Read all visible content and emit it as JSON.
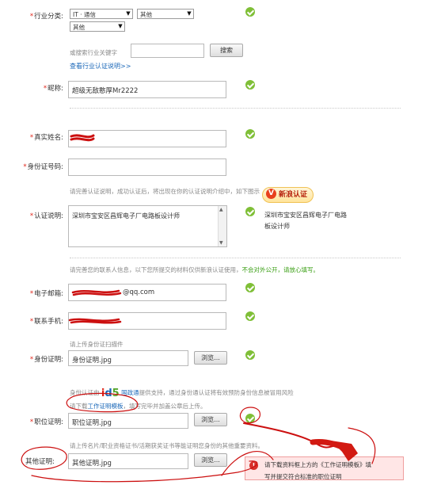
{
  "industry": {
    "label": "行业分类:",
    "select1": "IT · 通信",
    "select2": "其他",
    "select3": "其他",
    "search_placeholder": "或搜索行业关键字",
    "search_button": "搜索",
    "view_link": "查看行业认证说明>>"
  },
  "nickname": {
    "label": "昵称:",
    "value": "超级无敌憨厚Mr2222"
  },
  "real_name": {
    "label": "真实姓名:",
    "value": ""
  },
  "id_number": {
    "label": "身份证号码:",
    "value": ""
  },
  "verify_desc": {
    "hint": "请完善认证说明，成功认证后，将出现在你的认证说明介绍中，如下图示",
    "badge": "新浪认证",
    "badge_icon": "eye-logo",
    "label": "认证说明:",
    "value": "深圳市宝安区昌辉电子厂电路板设计师",
    "preview_line1": "深圳市宝安区昌辉电子厂电路",
    "preview_line2": "板设计师"
  },
  "contact_hint": {
    "text": "请完善您的联系人信息，以下您所提交的材料仅供新浪认证使用，",
    "green_text": "不会对外公开，请放心填写。"
  },
  "email": {
    "label": "电子邮箱:",
    "value": "@qq.com"
  },
  "phone": {
    "label": "联系手机:",
    "value": ""
  },
  "id_proof": {
    "hint": "请上传身份证扫描件",
    "label": "身份证明:",
    "file": "身份证明.jpg",
    "browse": "浏览..."
  },
  "id5_note": {
    "prefix": "身份认证由",
    "logo": "id5",
    "brand": "国政通",
    "suffix": "提供支持，通过身份通认证将有效预防身份信息被冒用风险"
  },
  "job_proof": {
    "hint_prefix": "请下载",
    "hint_link": "工作证明模板",
    "hint_suffix": "，填写完毕并加盖公章后上传。",
    "label": "职位证明:",
    "file": "职位证明.jpg",
    "browse": "浏览..."
  },
  "other_proof": {
    "hint": "请上传名片/职业资格证书/活期获奖证书等能证明您身份的其他重要资料。",
    "label": "其他证明:",
    "file": "其他证明.jpg",
    "browse": "浏览..."
  },
  "error_tooltip": {
    "line1": "请下载资料框上方的《工作证明模板》填",
    "line2": "写并提交符合标准的职位证明"
  },
  "colors": {
    "required": "#e0261b",
    "link": "#1a67b8",
    "check": "#7fbf37",
    "annotation": "#cc1010"
  }
}
